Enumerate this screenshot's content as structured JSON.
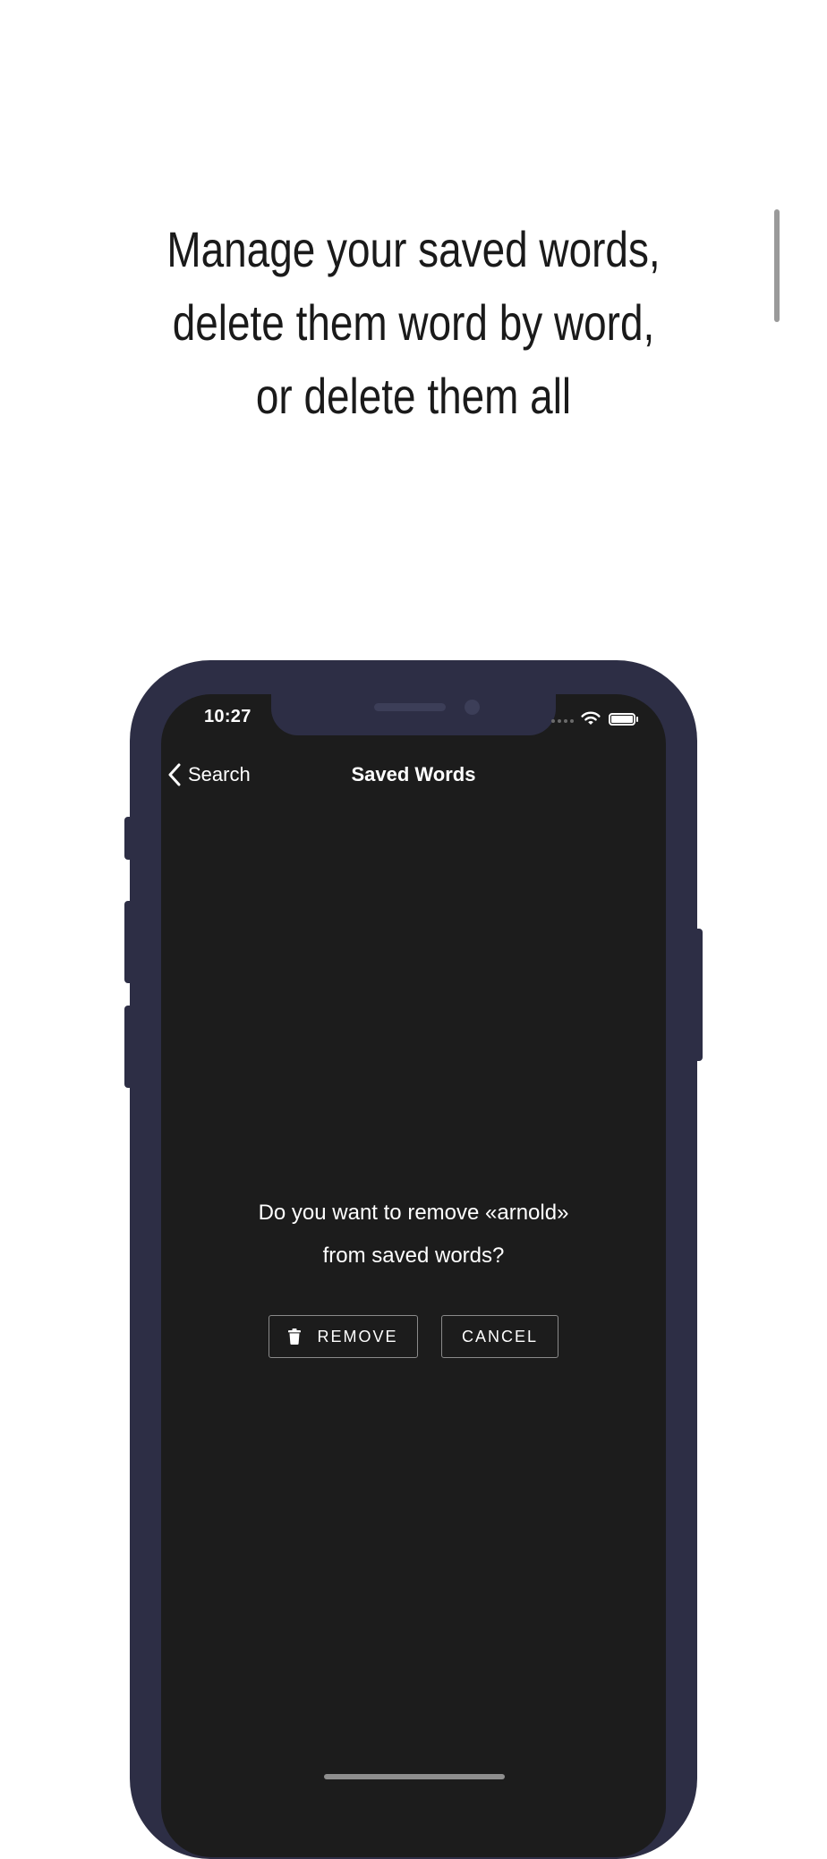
{
  "headline": {
    "line1": "Manage your saved words,",
    "line2": "delete them word by word,",
    "line3": "or delete them all"
  },
  "status_bar": {
    "time": "10:27"
  },
  "nav": {
    "back_label": "Search",
    "title": "Saved Words"
  },
  "dialog": {
    "line1": "Do you want to remove «arnold»",
    "line2": "from saved words?",
    "remove_label": "REMOVE",
    "cancel_label": "CANCEL"
  },
  "colors": {
    "phone_frame": "#2d2e45",
    "screen_background": "#1c1c1c",
    "page_background": "#ffffff"
  }
}
